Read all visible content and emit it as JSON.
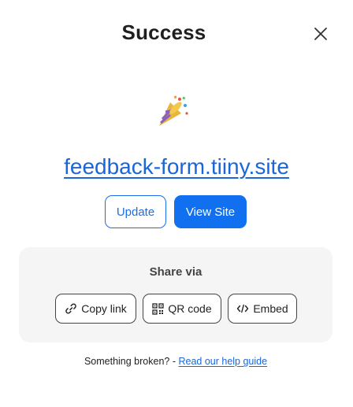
{
  "modal": {
    "title": "Success",
    "close_icon": "close-icon",
    "celebration_icon": "party-popper-icon",
    "site_url": "feedback-form.tiiny.site",
    "buttons": {
      "update_label": "Update",
      "view_site_label": "View Site"
    },
    "share": {
      "title": "Share via",
      "items": [
        {
          "label": "Copy link",
          "icon": "link-icon"
        },
        {
          "label": "QR code",
          "icon": "qr-code-icon"
        },
        {
          "label": "Embed",
          "icon": "code-icon"
        }
      ]
    },
    "footer": {
      "text": "Something broken? -",
      "link_label": "Read our help guide"
    }
  },
  "colors": {
    "accent": "#1170f0",
    "link": "#1a66d9",
    "share_background": "#f5f5f5"
  }
}
